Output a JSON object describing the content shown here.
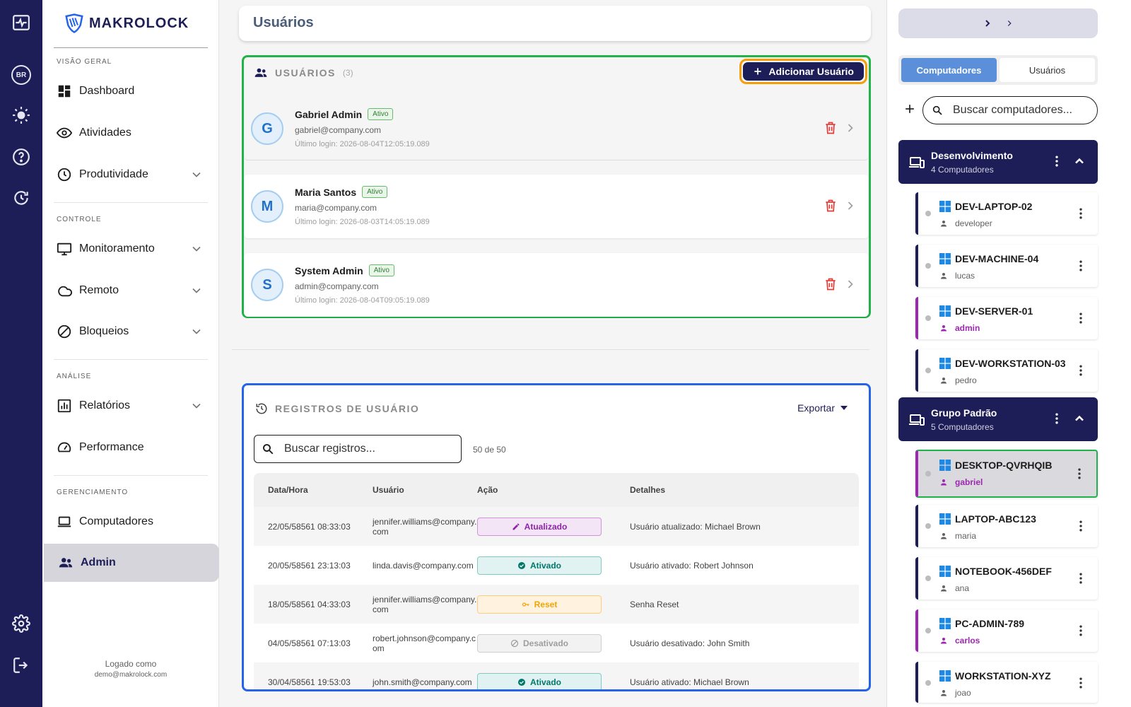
{
  "brand": {
    "name": "MAKROLOCK",
    "shield_color": "#2563eb",
    "navy": "#1d1e57"
  },
  "rail": {
    "language_badge": "BR"
  },
  "sidebar": {
    "sections": {
      "overview": "VISÃO GERAL",
      "control": "CONTROLE",
      "analysis": "ANÁLISE",
      "management": "GERENCIAMENTO"
    },
    "items": {
      "dashboard": "Dashboard",
      "activities": "Atividades",
      "productivity": "Produtividade",
      "monitoring": "Monitoramento",
      "remote": "Remoto",
      "blocks": "Bloqueios",
      "reports": "Relatórios",
      "performance": "Performance",
      "computers": "Computadores",
      "admin": "Admin"
    },
    "logged_label": "Logado como",
    "logged_user": "demo@makrolock.com"
  },
  "page": {
    "title": "Usuários"
  },
  "users_panel": {
    "heading": "USUÁRIOS",
    "count": "(3)",
    "add_button": "Adicionar Usuário",
    "users": [
      {
        "initial": "G",
        "name": "Gabriel Admin",
        "status": "Ativo",
        "email": "gabriel@company.com",
        "last_login": "Último login: 2026-08-04T12:05:19.089"
      },
      {
        "initial": "M",
        "name": "Maria Santos",
        "status": "Ativo",
        "email": "maria@company.com",
        "last_login": "Último login: 2026-08-03T14:05:19.089"
      },
      {
        "initial": "S",
        "name": "System Admin",
        "status": "Ativo",
        "email": "admin@company.com",
        "last_login": "Último login: 2026-08-04T09:05:19.089"
      }
    ]
  },
  "logs_panel": {
    "heading": "REGISTROS DE USUÁRIO",
    "export_label": "Exportar",
    "search_placeholder": "Buscar registros...",
    "result_count": "50 de 50",
    "columns": {
      "datetime": "Data/Hora",
      "user": "Usuário",
      "action": "Ação",
      "details": "Detalhes"
    },
    "rows": [
      {
        "datetime": "22/05/58561 08:33:03",
        "user": "jennifer.williams@company.com",
        "action": "Atualizado",
        "details": "Usuário atualizado: Michael Brown"
      },
      {
        "datetime": "20/05/58561 23:13:03",
        "user": "linda.davis@company.com",
        "action": "Ativado",
        "details": "Usuário ativado: Robert Johnson"
      },
      {
        "datetime": "18/05/58561 04:33:03",
        "user": "jennifer.williams@company.com",
        "action": "Reset",
        "details": "Senha Reset"
      },
      {
        "datetime": "04/05/58561 07:13:03",
        "user": "robert.johnson@company.com",
        "action": "Desativado",
        "details": "Usuário desativado: John Smith"
      },
      {
        "datetime": "30/04/58561 19:53:03",
        "user": "john.smith@company.com",
        "action": "Ativado",
        "details": "Usuário ativado: Michael Brown"
      }
    ]
  },
  "right_panel": {
    "tabs": {
      "computers": "Computadores",
      "users": "Usuários"
    },
    "search_placeholder": "Buscar computadores...",
    "groups": [
      {
        "name": "Desenvolvimento",
        "subtitle": "4 Computadores",
        "computers": [
          {
            "name": "DEV-LAPTOP-02",
            "user": "developer"
          },
          {
            "name": "DEV-MACHINE-04",
            "user": "lucas"
          },
          {
            "name": "DEV-SERVER-01",
            "user": "admin"
          },
          {
            "name": "DEV-WORKSTATION-03",
            "user": "pedro"
          }
        ]
      },
      {
        "name": "Grupo Padrão",
        "subtitle": "5 Computadores",
        "computers": [
          {
            "name": "DESKTOP-QVRHQIB",
            "user": "gabriel"
          },
          {
            "name": "LAPTOP-ABC123",
            "user": "maria"
          },
          {
            "name": "NOTEBOOK-456DEF",
            "user": "ana"
          },
          {
            "name": "PC-ADMIN-789",
            "user": "carlos"
          },
          {
            "name": "WORKSTATION-XYZ",
            "user": "joao"
          }
        ]
      }
    ]
  }
}
